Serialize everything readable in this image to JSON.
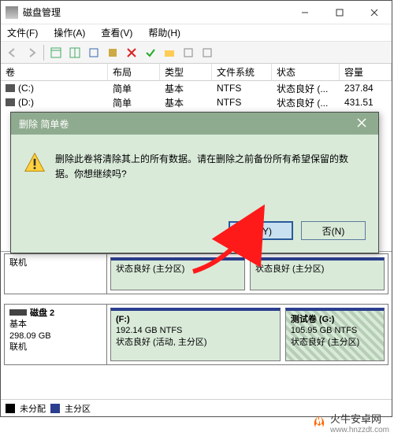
{
  "window": {
    "title": "磁盘管理"
  },
  "menubar": {
    "file": "文件(F)",
    "action": "操作(A)",
    "view": "查看(V)",
    "help": "帮助(H)"
  },
  "columns": {
    "vol": "卷",
    "layout": "布局",
    "type": "类型",
    "fs": "文件系统",
    "status": "状态",
    "cap": "容量"
  },
  "volumes": [
    {
      "name": "(C:)",
      "layout": "简单",
      "type": "基本",
      "fs": "NTFS",
      "status": "状态良好 (...",
      "cap": "237.84"
    },
    {
      "name": "(D:)",
      "layout": "简单",
      "type": "基本",
      "fs": "NTFS",
      "status": "状态良好 (...",
      "cap": "431.51"
    }
  ],
  "dialog": {
    "title": "删除 简单卷",
    "message": "删除此卷将清除其上的所有数据。请在删除之前备份所有希望保留的数据。你想继续吗?",
    "yes": "是(Y)",
    "no": "否(N)"
  },
  "disk1": {
    "sideStatus": "联机",
    "p1": "状态良好 (主分区)",
    "p2": "状态良好 (主分区)"
  },
  "disk2": {
    "name": "磁盘 2",
    "type": "基本",
    "size": "298.09 GB",
    "status": "联机",
    "p1": {
      "label": "(F:)",
      "line2": "192.14 GB NTFS",
      "line3": "状态良好 (活动, 主分区)"
    },
    "p2": {
      "label": "测试卷  (G:)",
      "line2": "105.95 GB NTFS",
      "line3": "状态良好 (主分区)"
    }
  },
  "legend": {
    "unalloc": "未分配",
    "primary": "主分区"
  },
  "watermark": {
    "name": "火牛安卓网",
    "url": "www.hnzzdt.com"
  }
}
